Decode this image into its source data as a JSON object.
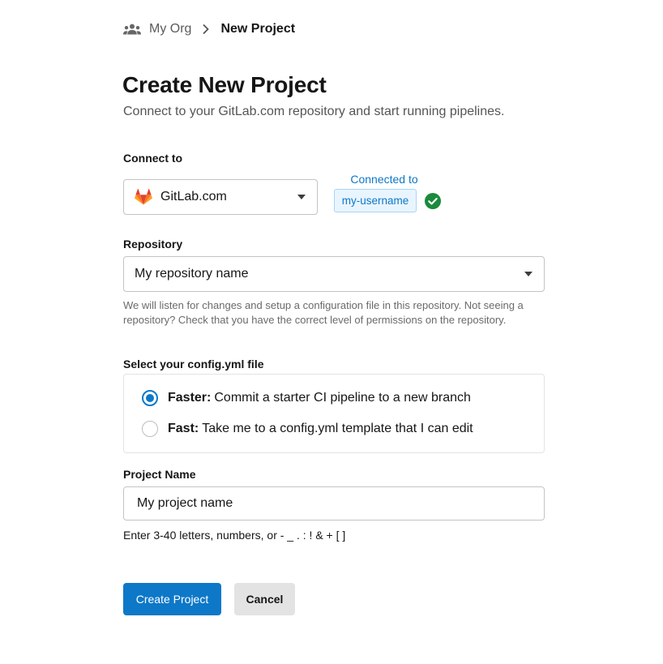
{
  "breadcrumb": {
    "org_icon": "people-icon",
    "org": "My Org",
    "separator_icon": "chevron-right-icon",
    "current": "New Project"
  },
  "page": {
    "title": "Create New Project",
    "subtitle": "Connect to your GitLab.com repository and start running pipelines."
  },
  "connect": {
    "label": "Connect to",
    "provider_icon": "gitlab-icon",
    "provider": "GitLab.com",
    "connected_label": "Connected to",
    "username": "my-username",
    "status_icon": "check-circle-icon"
  },
  "repository": {
    "label": "Repository",
    "value": "My repository name",
    "helper": "We will listen for changes and setup a configuration file in this repository. Not seeing a repository? Check that you have the correct level of permissions on the repository."
  },
  "config": {
    "label": "Select your config.yml file",
    "options": [
      {
        "title": "Faster:",
        "text": "Commit a starter CI pipeline to a new branch",
        "selected": true
      },
      {
        "title": "Fast:",
        "text": "Take me to a config.yml template that I can edit",
        "selected": false
      }
    ]
  },
  "project_name": {
    "label": "Project Name",
    "value": "My project name",
    "helper": "Enter 3-40 letters, numbers, or - _ . : ! & + [ ]"
  },
  "actions": {
    "create": "Create Project",
    "cancel": "Cancel"
  },
  "colors": {
    "primary": "#0d78c8",
    "success": "#1a8a3c",
    "gitlab_orange": "#e2432a"
  }
}
